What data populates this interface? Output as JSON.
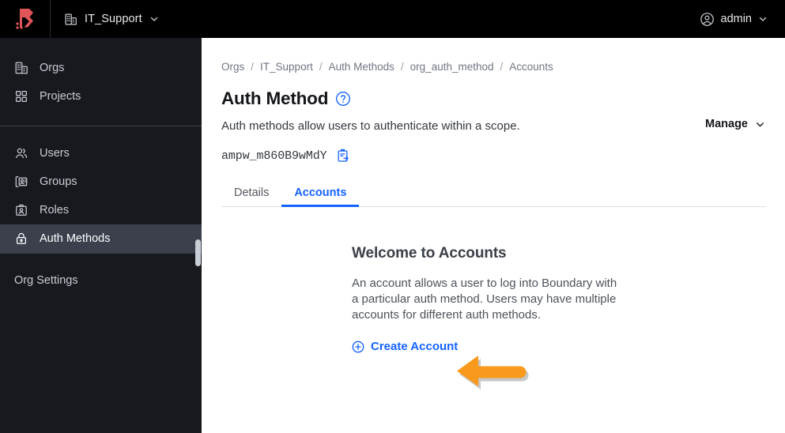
{
  "topbar": {
    "logo_icon": "boundary-logo-icon",
    "scope_icon": "org-building-icon",
    "scope_label": "IT_Support",
    "scope_chevron_icon": "chevron-down-icon",
    "user_icon": "user-circle-icon",
    "user_name": "admin",
    "user_chevron_icon": "chevron-down-icon",
    "bg_color": "#000000"
  },
  "sidebar": {
    "bg_color": "#17191e",
    "active_bg_color": "#3b404c",
    "groups": [
      {
        "items": [
          {
            "label": "Orgs",
            "icon": "org-building-icon",
            "active": false
          },
          {
            "label": "Projects",
            "icon": "grid-squares-icon",
            "active": false
          }
        ]
      },
      {
        "items": [
          {
            "label": "Users",
            "icon": "users-icon",
            "active": false
          },
          {
            "label": "Groups",
            "icon": "group-folder-icon",
            "active": false
          },
          {
            "label": "Roles",
            "icon": "id-badge-icon",
            "active": false
          },
          {
            "label": "Auth Methods",
            "icon": "lock-icon",
            "active": true
          }
        ]
      },
      {
        "items": [
          {
            "label": "Org Settings",
            "icon": null,
            "active": false
          }
        ]
      }
    ],
    "scrollbar": {
      "name": "sidebar-scrollbar",
      "color": "#c9cdd6"
    }
  },
  "breadcrumb": {
    "items": [
      "Orgs",
      "IT_Support",
      "Auth Methods",
      "org_auth_method",
      "Accounts"
    ],
    "separator": "/"
  },
  "header": {
    "title": "Auth Method",
    "help_icon": "help-circle-icon",
    "subtitle": "Auth methods allow users to authenticate within a scope.",
    "manage_label": "Manage",
    "manage_chevron_icon": "chevron-down-icon",
    "resource_id": "ampw_m860B9wMdY",
    "copy_icon": "copy-clipboard-icon"
  },
  "tabs": [
    {
      "label": "Details",
      "active": false
    },
    {
      "label": "Accounts",
      "active": true
    }
  ],
  "empty_state": {
    "title": "Welcome to Accounts",
    "body": "An account allows a user to log into Boundary with a particular auth method. Users may have multiple accounts for different auth methods.",
    "create_icon": "plus-circle-icon",
    "create_label": "Create Account"
  },
  "annotation": {
    "arrow_icon": "orange-left-arrow-icon",
    "color": "#f99a1c"
  },
  "colors": {
    "accent_blue": "#1563ff",
    "brand_red": "#e0555a",
    "annotation_orange": "#f99a1c"
  }
}
